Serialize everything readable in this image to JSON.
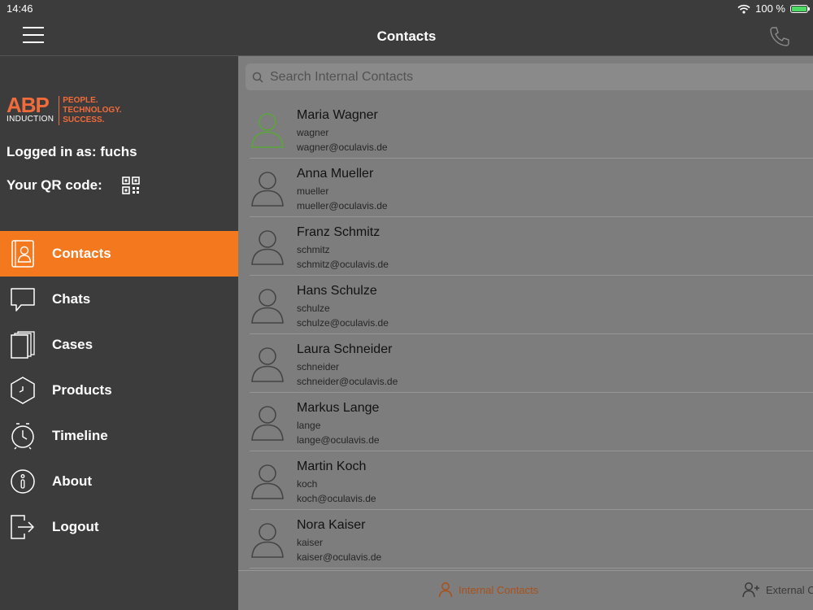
{
  "status": {
    "time": "14:46",
    "battery": "100 %",
    "battery_level": 1.0
  },
  "header": {
    "title": "Contacts"
  },
  "sidebar": {
    "logo": {
      "brand": "ABP",
      "sub": "INDUCTION",
      "tagline": [
        "PEOPLE.",
        "TECHNOLOGY.",
        "SUCCESS."
      ]
    },
    "logged_in": "Logged in as: fuchs",
    "qr_label": "Your QR code:",
    "items": [
      {
        "label": "Contacts",
        "icon": "contacts-book-icon",
        "active": true
      },
      {
        "label": "Chats",
        "icon": "chat-bubble-icon"
      },
      {
        "label": "Cases",
        "icon": "cases-files-icon"
      },
      {
        "label": "Products",
        "icon": "products-hexagon-icon"
      },
      {
        "label": "Timeline",
        "icon": "timeline-clock-icon"
      },
      {
        "label": "About",
        "icon": "info-icon"
      },
      {
        "label": "Logout",
        "icon": "logout-icon"
      }
    ]
  },
  "search": {
    "placeholder": "Search Internal Contacts",
    "value": ""
  },
  "contacts": [
    {
      "name": "Maria Wagner",
      "username": "wagner",
      "email": "wagner@oculavis.de",
      "online": true
    },
    {
      "name": "Anna Mueller",
      "username": "mueller",
      "email": "mueller@oculavis.de"
    },
    {
      "name": "Franz Schmitz",
      "username": "schmitz",
      "email": "schmitz@oculavis.de"
    },
    {
      "name": "Hans Schulze",
      "username": "schulze",
      "email": "schulze@oculavis.de"
    },
    {
      "name": "Laura Schneider",
      "username": "schneider",
      "email": "schneider@oculavis.de"
    },
    {
      "name": "Markus Lange",
      "username": "lange",
      "email": "lange@oculavis.de"
    },
    {
      "name": "Martin Koch",
      "username": "koch",
      "email": "koch@oculavis.de"
    },
    {
      "name": "Nora Kaiser",
      "username": "kaiser",
      "email": "kaiser@oculavis.de"
    }
  ],
  "tabs": [
    {
      "label": "Internal Contacts",
      "active": true
    },
    {
      "label": "External C"
    }
  ],
  "colors": {
    "accent": "#f4781e",
    "logo": "#f26b3a",
    "online": "#5aa63a",
    "sidebar": "#3c3c3c"
  }
}
